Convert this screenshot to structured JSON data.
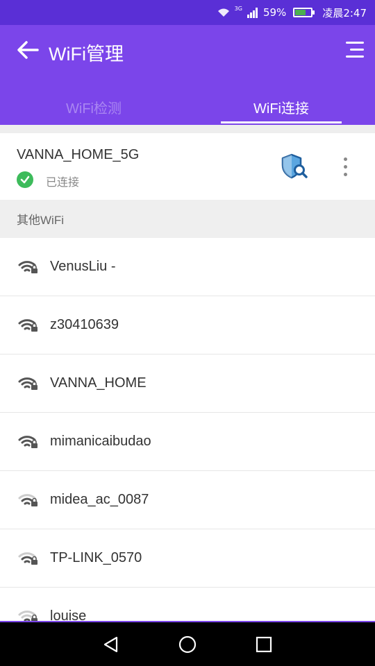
{
  "status_bar": {
    "network": "3G",
    "battery": "59%",
    "time": "凌晨2:47"
  },
  "header": {
    "title": "WiFi管理"
  },
  "tabs": [
    {
      "label": "WiFi检测",
      "active": false
    },
    {
      "label": "WiFi连接",
      "active": true
    }
  ],
  "connected": {
    "ssid": "VANNA_HOME_5G",
    "status": "已连接"
  },
  "section": {
    "title": "其他WiFi"
  },
  "networks": [
    {
      "name": "VenusLiu -"
    },
    {
      "name": "z30410639"
    },
    {
      "name": "VANNA_HOME"
    },
    {
      "name": "mimanicaibudao"
    },
    {
      "name": "midea_ac_0087"
    },
    {
      "name": "TP-LINK_0570"
    },
    {
      "name": "louise"
    }
  ],
  "colors": {
    "header": "#7b45ea",
    "status_bar": "#5a2fd6",
    "connected_check": "#3dbb5b",
    "shield": "#2a6fb3"
  }
}
